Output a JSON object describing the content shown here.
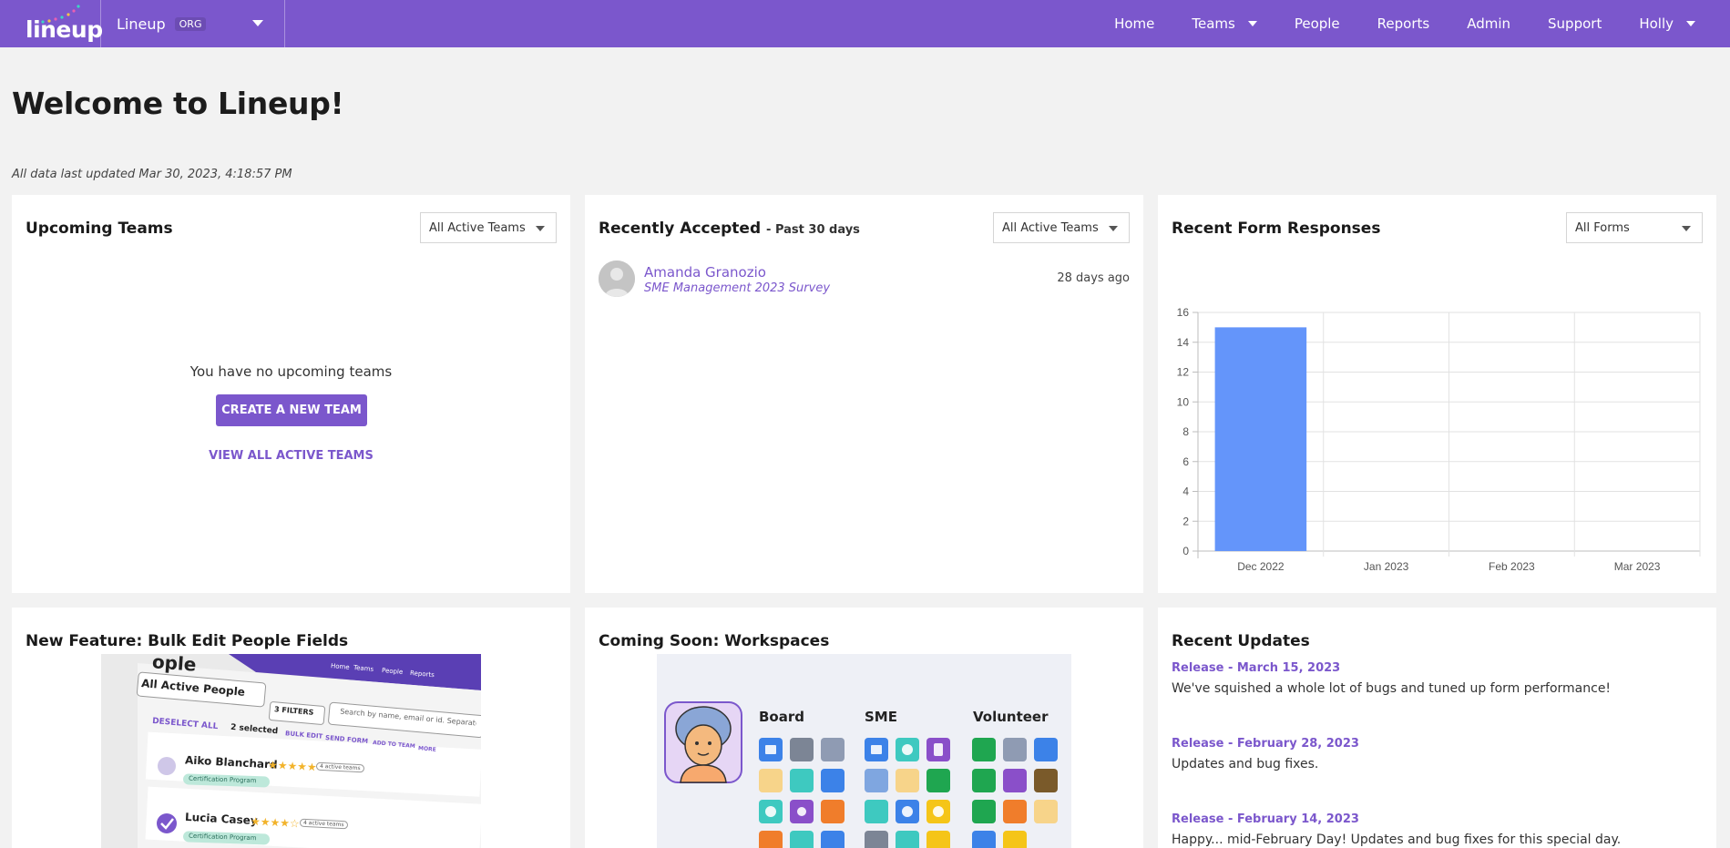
{
  "nav": {
    "logo_text": "lineup",
    "org_name": "Lineup",
    "org_badge": "ORG",
    "links": [
      "Home",
      "Teams",
      "People",
      "Reports",
      "Admin",
      "Support",
      "Holly"
    ],
    "accent": "#7b57cc"
  },
  "page": {
    "title": "Welcome to Lineup!",
    "last_updated": "All data last updated Mar 30, 2023, 4:18:57 PM"
  },
  "upcoming": {
    "title": "Upcoming Teams",
    "filter": "All Active Teams",
    "empty": "You have no upcoming teams",
    "create_button": "CREATE A NEW TEAM",
    "view_all": "VIEW ALL ACTIVE TEAMS"
  },
  "accepted": {
    "title": "Recently Accepted",
    "subtitle": "- Past 30 days",
    "filter": "All Active Teams",
    "items": [
      {
        "name": "Amanda Granozio",
        "form": "SME Management 2023 Survey",
        "time": "28 days ago"
      }
    ]
  },
  "forms": {
    "title": "Recent Form Responses",
    "filter": "All Forms"
  },
  "chart_data": {
    "type": "bar",
    "categories": [
      "Dec 2022",
      "Jan 2023",
      "Feb 2023",
      "Mar 2023"
    ],
    "values": [
      15,
      0,
      0,
      0
    ],
    "ylim": [
      0,
      16
    ],
    "yticks": [
      0,
      2,
      4,
      6,
      8,
      10,
      12,
      14,
      16
    ],
    "grid": true,
    "bar_color": "#6495fa"
  },
  "feature": {
    "title": "New Feature: Bulk Edit People Fields",
    "screenshot": {
      "filter_label": "All Active People",
      "filters_btn": "3 FILTERS",
      "search_placeholder": "Search by name, email or id. Separate emails by",
      "deselect": "DESELECT ALL",
      "selected": "2 selected",
      "bulk_edit": "BULK EDIT",
      "send_form": "SEND FORM",
      "add_team": "ADD TO TEAM",
      "more": "MORE",
      "nav_home": "Home",
      "nav_teams": "Teams",
      "nav_people": "People",
      "nav_reports": "Reports",
      "people": [
        {
          "name": "Aiko Blanchard",
          "tag": "Certification Program",
          "teams": "4 active teams"
        },
        {
          "name": "Lucia Casey",
          "tag": "Certification Program",
          "teams": "4 active teams"
        }
      ]
    }
  },
  "workspaces": {
    "title": "Coming Soon: Workspaces",
    "columns": [
      "Board",
      "SME",
      "Volunteer"
    ]
  },
  "updates": {
    "title": "Recent Updates",
    "items": [
      {
        "title": "Release - March 15, 2023",
        "desc": "We've squished a whole lot of bugs and tuned up form performance!"
      },
      {
        "title": "Release - February 28, 2023",
        "desc": "Updates and bug fixes."
      },
      {
        "title": "Release - February 14, 2023",
        "desc": "Happy... mid-February Day! Updates and bug fixes for this special day."
      }
    ]
  }
}
